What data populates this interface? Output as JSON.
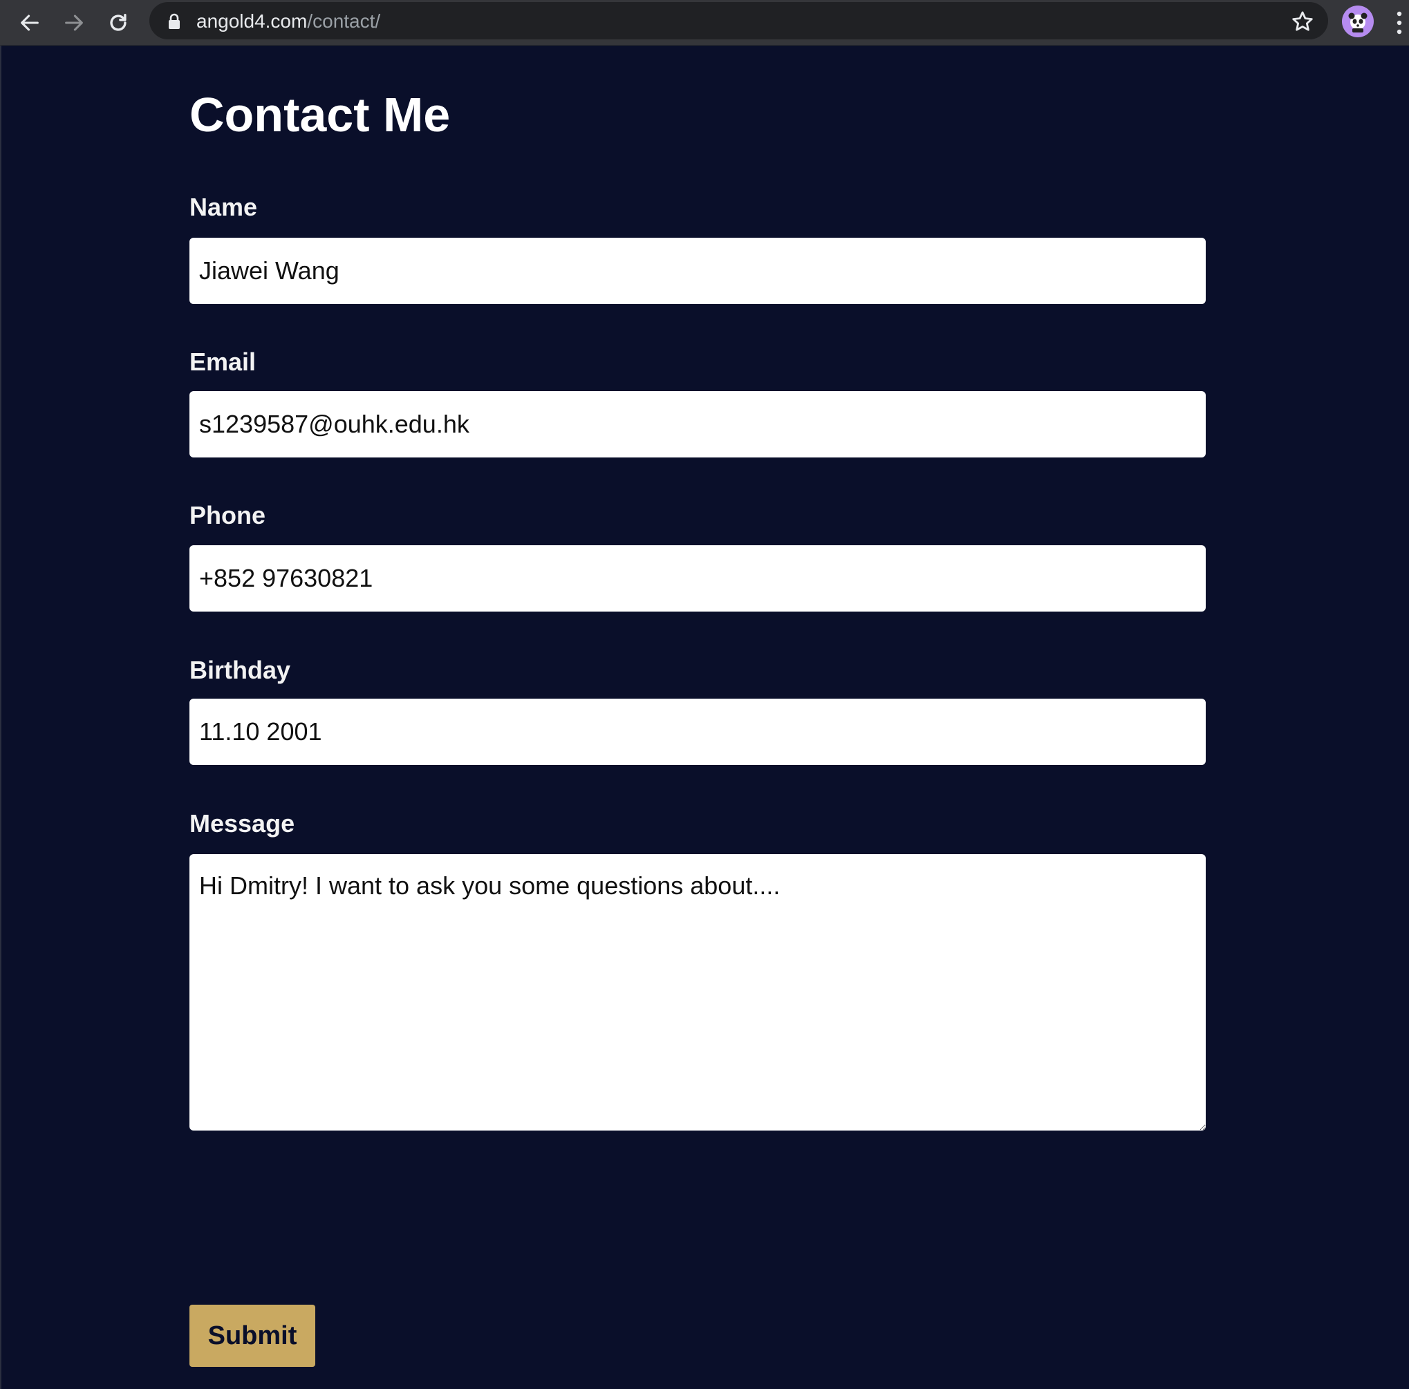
{
  "browser": {
    "url_host": "angold4.com",
    "url_path": "/contact/",
    "icons": {
      "back": "arrow-left-icon",
      "forward": "arrow-right-icon",
      "reload": "reload-icon",
      "lock": "lock-icon",
      "bookmark": "star-icon",
      "profile": "profile-avatar",
      "menu": "kebab-menu-icon"
    }
  },
  "page": {
    "title": "Contact Me",
    "form": {
      "name": {
        "label": "Name",
        "value": "Jiawei Wang"
      },
      "email": {
        "label": "Email",
        "value": "s1239587@ouhk.edu.hk"
      },
      "phone": {
        "label": "Phone",
        "value": "+852 97630821"
      },
      "birthday": {
        "label": "Birthday",
        "value": "11.10 2001"
      },
      "message": {
        "label": "Message",
        "value": "Hi Dmitry! I want to ask you some questions about...."
      },
      "submit_label": "Submit"
    }
  },
  "colors": {
    "page_background": "#0a0f2a",
    "chrome_background": "#35363a",
    "omnibox_background": "#202124",
    "accent_button": "#c9a961",
    "avatar": "#b68cf0"
  }
}
